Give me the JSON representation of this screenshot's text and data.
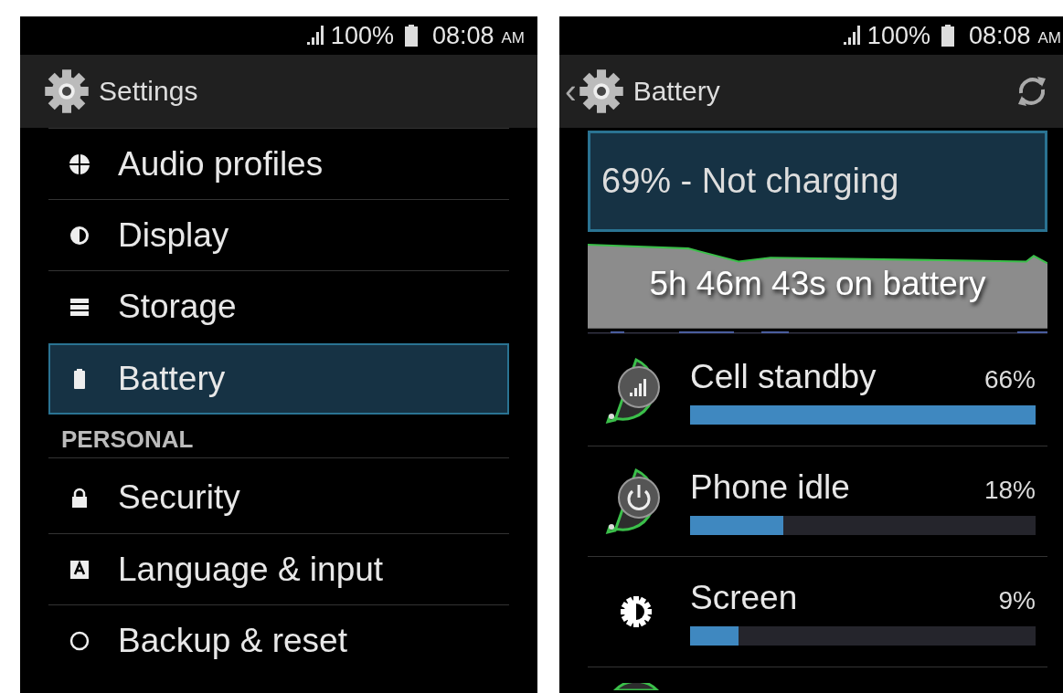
{
  "settings_screen": {
    "status_bar": {
      "battery": "100%",
      "time": "08:08",
      "meridiem": "AM"
    },
    "action_bar": {
      "title": "Settings"
    },
    "items": [
      {
        "kind": "item",
        "label": "Audio profiles",
        "selected": false
      },
      {
        "kind": "item",
        "label": "Display",
        "selected": false
      },
      {
        "kind": "item",
        "label": "Storage",
        "selected": false
      },
      {
        "kind": "item",
        "label": "Battery",
        "selected": true
      },
      {
        "kind": "header",
        "label": "PERSONAL"
      },
      {
        "kind": "item",
        "label": "Security",
        "selected": false
      },
      {
        "kind": "item",
        "label": "Language & input",
        "selected": false
      },
      {
        "kind": "item",
        "label": "Backup & reset",
        "selected": false
      }
    ]
  },
  "battery_screen": {
    "status_bar": {
      "battery": "100%",
      "time": "08:08",
      "meridiem": "AM"
    },
    "action_bar": {
      "back": "‹",
      "title": "Battery"
    },
    "status": "69% - Not charging",
    "history": "5h 46m 43s on battery",
    "usage": [
      {
        "name": "Cell standby",
        "percent": "66%",
        "level": 1.0
      },
      {
        "name": "Phone idle",
        "percent": "18%",
        "level": 0.27
      },
      {
        "name": "Screen",
        "percent": "9%",
        "level": 0.14
      }
    ]
  }
}
